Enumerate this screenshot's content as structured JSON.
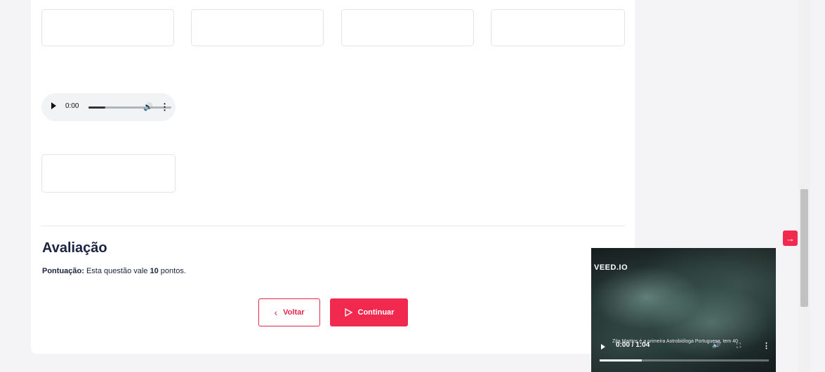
{
  "audio": {
    "time": "0:00",
    "progress": 0.2
  },
  "evaluation": {
    "title": "Avaliação",
    "score_label": "Pontuação:",
    "score_text_before": "Esta questão vale",
    "score_value": "10",
    "score_text_after": "pontos."
  },
  "buttons": {
    "back_label": "Voltar",
    "continue_label": "Continuar"
  },
  "video": {
    "logo": "VEED.IO",
    "caption": "Zita Martins é a primeira Astrobióloga Portuguesa, tem 40",
    "time": "0:00 / 1:04",
    "progress": 0.25
  },
  "colors": {
    "accent": "#f2294f",
    "text": "#1a2340",
    "border": "#e2e4ea"
  },
  "icons": [
    "play-icon",
    "volume-icon",
    "more-vertical-icon",
    "chevron-left-icon",
    "play-outline-icon",
    "arrow-right-icon",
    "fullscreen-icon"
  ]
}
